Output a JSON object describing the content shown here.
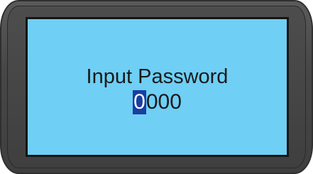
{
  "screen": {
    "title": "Input Password",
    "digits": [
      "0",
      "0",
      "0",
      "0"
    ],
    "selected_index": 0
  },
  "colors": {
    "screen_background": "#6fcff5",
    "bezel": "#474747",
    "cursor_highlight": "#1b3ea1",
    "text": "#1a1a1a"
  }
}
